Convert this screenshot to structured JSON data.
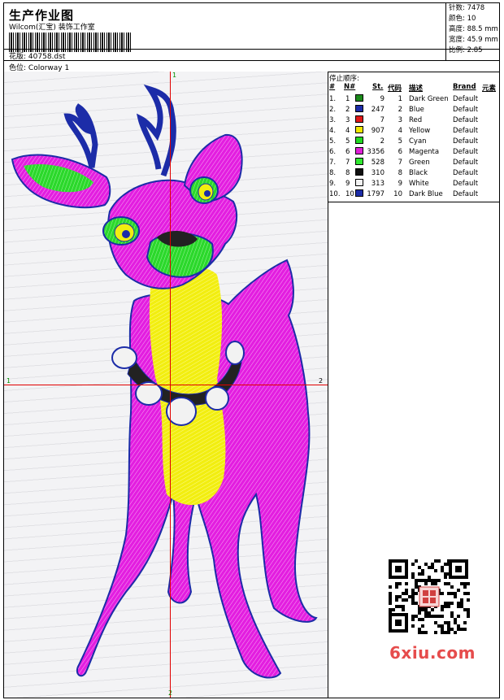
{
  "header": {
    "title": "生产作业图",
    "company": "Wilcom(汇宝) 装饰工作室",
    "design_label": "花版:",
    "design_value": "40758.dst",
    "colorway_label": "色位:",
    "colorway_value": "Colorway 1"
  },
  "stats": [
    {
      "label": "针数:",
      "value": "7478"
    },
    {
      "label": "颜色:",
      "value": "10"
    },
    {
      "label": "高度:",
      "value": "88.5 mm"
    },
    {
      "label": "宽度:",
      "value": "45.9 mm"
    },
    {
      "label": "比例:",
      "value": "2.85"
    }
  ],
  "canvas": {
    "axis_top": "1",
    "axis_bottom": "2",
    "axis_left": "1",
    "axis_right": "2"
  },
  "color_table": {
    "title": "停止顺序:",
    "headers": {
      "order": "#",
      "needle": "N#",
      "stitches": "St.",
      "code": "代码",
      "desc": "描述",
      "brand": "Brand",
      "element": "元素"
    },
    "rows": [
      {
        "order": "1.",
        "needle": "1",
        "color": "#1a8a1a",
        "stitches": "9",
        "code": "1",
        "desc": "Dark Green",
        "brand": "Default"
      },
      {
        "order": "2.",
        "needle": "2",
        "color": "#1c2ca8",
        "stitches": "247",
        "code": "2",
        "desc": "Blue",
        "brand": "Default"
      },
      {
        "order": "3.",
        "needle": "3",
        "color": "#e01818",
        "stitches": "7",
        "code": "3",
        "desc": "Red",
        "brand": "Default"
      },
      {
        "order": "4.",
        "needle": "4",
        "color": "#f0e800",
        "stitches": "907",
        "code": "4",
        "desc": "Yellow",
        "brand": "Default"
      },
      {
        "order": "5.",
        "needle": "5",
        "color": "#22d822",
        "stitches": "2",
        "code": "5",
        "desc": "Cyan",
        "brand": "Default"
      },
      {
        "order": "6.",
        "needle": "6",
        "color": "#e020d8",
        "stitches": "3356",
        "code": "6",
        "desc": "Magenta",
        "brand": "Default"
      },
      {
        "order": "7.",
        "needle": "7",
        "color": "#30e830",
        "stitches": "528",
        "code": "7",
        "desc": "Green",
        "brand": "Default"
      },
      {
        "order": "8.",
        "needle": "8",
        "color": "#101010",
        "stitches": "310",
        "code": "8",
        "desc": "Black",
        "brand": "Default"
      },
      {
        "order": "9.",
        "needle": "9",
        "color": "#f2f2f2",
        "stitches": "313",
        "code": "9",
        "desc": "White",
        "brand": "Default"
      },
      {
        "order": "10.",
        "needle": "10",
        "color": "#1c2ca8",
        "stitches": "1797",
        "code": "10",
        "desc": "Dark Blue",
        "brand": "Default"
      }
    ]
  },
  "watermark": "6xiu.com"
}
